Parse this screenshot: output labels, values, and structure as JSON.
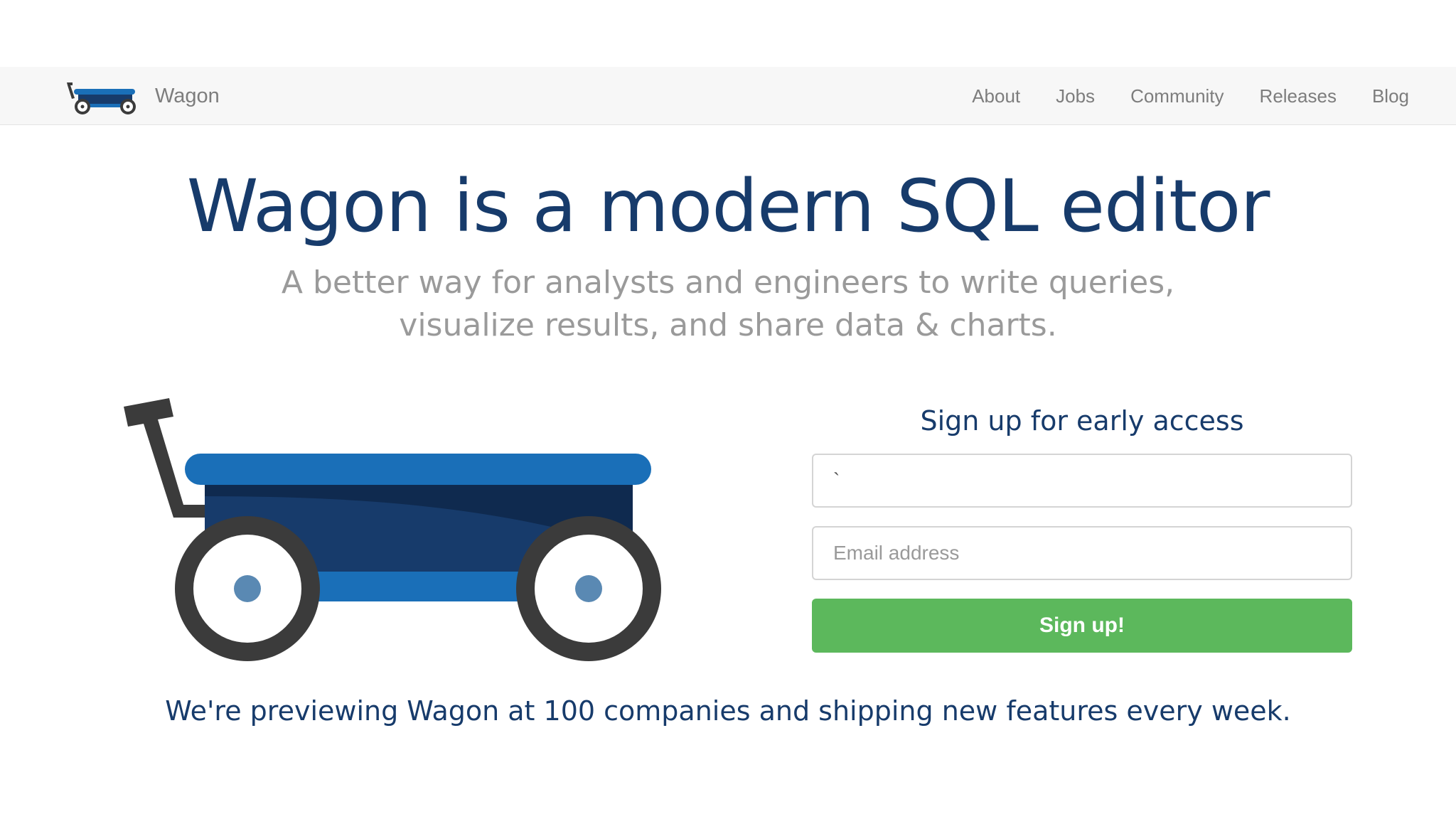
{
  "nav": {
    "brand": "Wagon",
    "logo_icon": "wagon-logo-icon",
    "links": [
      {
        "label": "About"
      },
      {
        "label": "Jobs"
      },
      {
        "label": "Community"
      },
      {
        "label": "Releases"
      },
      {
        "label": "Blog"
      }
    ]
  },
  "hero": {
    "title": "Wagon is a modern SQL editor",
    "subtitle_line1": "A better way for analysts and engineers to write queries,",
    "subtitle_line2": "visualize results, and share data & charts."
  },
  "illustration": {
    "icon": "wagon-illustration-icon"
  },
  "signup": {
    "title": "Sign up for early access",
    "first_field_value": "`",
    "email_placeholder": "Email address",
    "email_value": "",
    "submit_label": "Sign up!"
  },
  "footer_note": "We're previewing Wagon at 100 companies and shipping new features every week.",
  "colors": {
    "navy": "#173b6b",
    "blue": "#1a6fb8",
    "green": "#5cb85c",
    "gray_text": "#7d7d7d",
    "navbar_bg": "#f7f7f7",
    "wheel": "#3b3b3b"
  }
}
